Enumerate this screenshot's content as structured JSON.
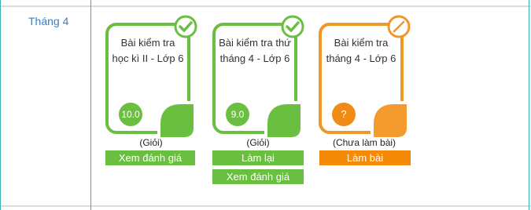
{
  "month_label": "Tháng 4",
  "colors": {
    "green": "#6abf40",
    "orange": "#f08c16"
  },
  "tests": [
    {
      "title": "Bài kiểm tra học kì II - Lớp 6",
      "score": "10.0",
      "status": "(Giỏi)",
      "state": "completed",
      "badge_icon": "check-icon",
      "buttons": [
        "Xem đánh giá"
      ]
    },
    {
      "title": "Bài kiểm tra thứ tháng 4 - Lớp 6",
      "score": "9.0",
      "status": "(Giỏi)",
      "state": "completed",
      "badge_icon": "check-icon",
      "buttons": [
        "Làm lại",
        "Xem đánh giá"
      ]
    },
    {
      "title": "Bài kiểm tra tháng 4 - Lớp 6",
      "score": "?",
      "status": "(Chưa làm bài)",
      "state": "not-done",
      "badge_icon": "not-done-icon",
      "buttons": [
        "Làm bài"
      ]
    }
  ]
}
